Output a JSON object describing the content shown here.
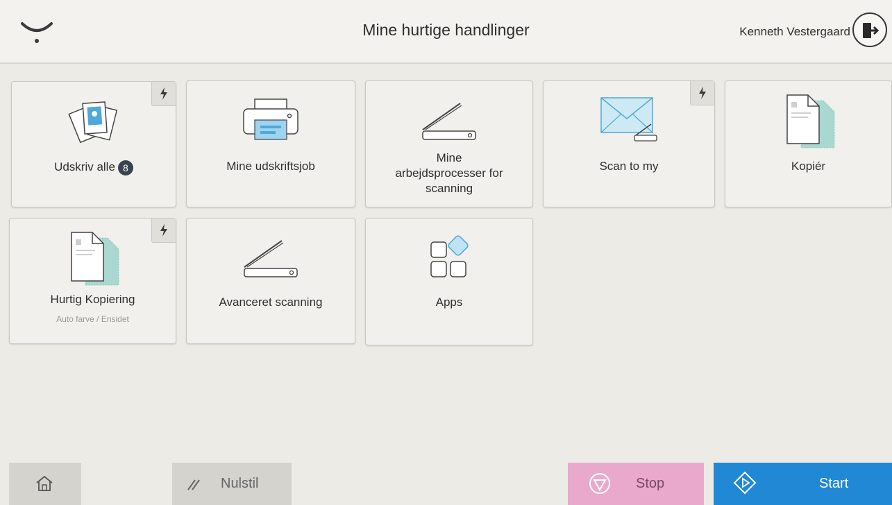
{
  "header": {
    "title": "Mine hurtige handlinger",
    "user_name": "Kenneth Vestergaard"
  },
  "tiles": [
    {
      "label": "Udskriv alle",
      "badge": "8",
      "icon": "documents-photo-icon",
      "quick": true
    },
    {
      "label": "Mine udskriftsjob",
      "icon": "printer-icon",
      "quick": false
    },
    {
      "label_lines": [
        "Mine",
        "arbejdsprocesser for",
        "scanning"
      ],
      "icon": "scanner-icon",
      "quick": false
    },
    {
      "label": "Scan to my",
      "icon": "envelope-scanner-icon",
      "quick": true
    },
    {
      "label": "Kopiér",
      "icon": "copy-document-icon",
      "quick": false
    },
    {
      "label": "Hurtig Kopiering",
      "sublabel": "Auto farve / Ensidet",
      "icon": "copy-document-icon",
      "quick": true
    },
    {
      "label": "Avanceret scanning",
      "icon": "scanner-icon",
      "quick": false
    },
    {
      "label": "Apps",
      "icon": "apps-grid-icon",
      "quick": false
    }
  ],
  "bottom_bar": {
    "home_icon": "home-icon",
    "reset_label": "Nulstil",
    "stop_label": "Stop",
    "start_label": "Start"
  },
  "colors": {
    "background": "#ecebe6",
    "tile": "#f1f0ec",
    "stop": "#e8a9cd",
    "start": "#2088d4",
    "neutral_button": "#d4d3ce",
    "icon_blue": "#4ea8dc",
    "icon_teal": "#a8d8d0"
  }
}
